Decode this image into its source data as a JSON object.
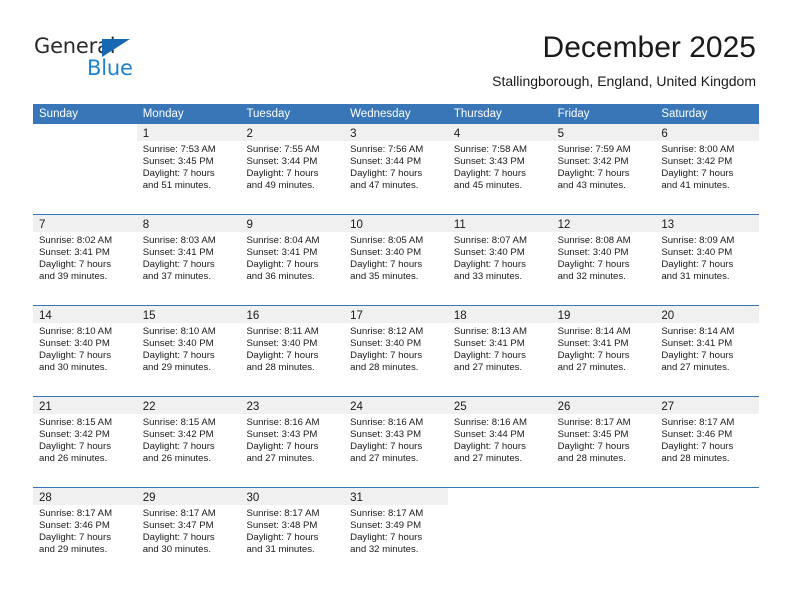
{
  "brand": {
    "name_top": "General",
    "name_bottom": "Blue",
    "triangle_color": "#1668b3",
    "blue_color": "#1f82d0"
  },
  "header": {
    "title": "December 2025",
    "subtitle": "Stallingborough, England, United Kingdom"
  },
  "colors": {
    "header_blue": "#3876b8",
    "daynum_band": "#f0f0f0",
    "text": "#1a1a1a"
  },
  "weekday_headers": [
    "Sunday",
    "Monday",
    "Tuesday",
    "Wednesday",
    "Thursday",
    "Friday",
    "Saturday"
  ],
  "weeks": [
    [
      {
        "blank": true
      },
      {
        "day": "1",
        "sunrise": "Sunrise: 7:53 AM",
        "sunset": "Sunset: 3:45 PM",
        "daylight1": "Daylight: 7 hours",
        "daylight2": "and 51 minutes."
      },
      {
        "day": "2",
        "sunrise": "Sunrise: 7:55 AM",
        "sunset": "Sunset: 3:44 PM",
        "daylight1": "Daylight: 7 hours",
        "daylight2": "and 49 minutes."
      },
      {
        "day": "3",
        "sunrise": "Sunrise: 7:56 AM",
        "sunset": "Sunset: 3:44 PM",
        "daylight1": "Daylight: 7 hours",
        "daylight2": "and 47 minutes."
      },
      {
        "day": "4",
        "sunrise": "Sunrise: 7:58 AM",
        "sunset": "Sunset: 3:43 PM",
        "daylight1": "Daylight: 7 hours",
        "daylight2": "and 45 minutes."
      },
      {
        "day": "5",
        "sunrise": "Sunrise: 7:59 AM",
        "sunset": "Sunset: 3:42 PM",
        "daylight1": "Daylight: 7 hours",
        "daylight2": "and 43 minutes."
      },
      {
        "day": "6",
        "sunrise": "Sunrise: 8:00 AM",
        "sunset": "Sunset: 3:42 PM",
        "daylight1": "Daylight: 7 hours",
        "daylight2": "and 41 minutes."
      }
    ],
    [
      {
        "day": "7",
        "sunrise": "Sunrise: 8:02 AM",
        "sunset": "Sunset: 3:41 PM",
        "daylight1": "Daylight: 7 hours",
        "daylight2": "and 39 minutes."
      },
      {
        "day": "8",
        "sunrise": "Sunrise: 8:03 AM",
        "sunset": "Sunset: 3:41 PM",
        "daylight1": "Daylight: 7 hours",
        "daylight2": "and 37 minutes."
      },
      {
        "day": "9",
        "sunrise": "Sunrise: 8:04 AM",
        "sunset": "Sunset: 3:41 PM",
        "daylight1": "Daylight: 7 hours",
        "daylight2": "and 36 minutes."
      },
      {
        "day": "10",
        "sunrise": "Sunrise: 8:05 AM",
        "sunset": "Sunset: 3:40 PM",
        "daylight1": "Daylight: 7 hours",
        "daylight2": "and 35 minutes."
      },
      {
        "day": "11",
        "sunrise": "Sunrise: 8:07 AM",
        "sunset": "Sunset: 3:40 PM",
        "daylight1": "Daylight: 7 hours",
        "daylight2": "and 33 minutes."
      },
      {
        "day": "12",
        "sunrise": "Sunrise: 8:08 AM",
        "sunset": "Sunset: 3:40 PM",
        "daylight1": "Daylight: 7 hours",
        "daylight2": "and 32 minutes."
      },
      {
        "day": "13",
        "sunrise": "Sunrise: 8:09 AM",
        "sunset": "Sunset: 3:40 PM",
        "daylight1": "Daylight: 7 hours",
        "daylight2": "and 31 minutes."
      }
    ],
    [
      {
        "day": "14",
        "sunrise": "Sunrise: 8:10 AM",
        "sunset": "Sunset: 3:40 PM",
        "daylight1": "Daylight: 7 hours",
        "daylight2": "and 30 minutes."
      },
      {
        "day": "15",
        "sunrise": "Sunrise: 8:10 AM",
        "sunset": "Sunset: 3:40 PM",
        "daylight1": "Daylight: 7 hours",
        "daylight2": "and 29 minutes."
      },
      {
        "day": "16",
        "sunrise": "Sunrise: 8:11 AM",
        "sunset": "Sunset: 3:40 PM",
        "daylight1": "Daylight: 7 hours",
        "daylight2": "and 28 minutes."
      },
      {
        "day": "17",
        "sunrise": "Sunrise: 8:12 AM",
        "sunset": "Sunset: 3:40 PM",
        "daylight1": "Daylight: 7 hours",
        "daylight2": "and 28 minutes."
      },
      {
        "day": "18",
        "sunrise": "Sunrise: 8:13 AM",
        "sunset": "Sunset: 3:41 PM",
        "daylight1": "Daylight: 7 hours",
        "daylight2": "and 27 minutes."
      },
      {
        "day": "19",
        "sunrise": "Sunrise: 8:14 AM",
        "sunset": "Sunset: 3:41 PM",
        "daylight1": "Daylight: 7 hours",
        "daylight2": "and 27 minutes."
      },
      {
        "day": "20",
        "sunrise": "Sunrise: 8:14 AM",
        "sunset": "Sunset: 3:41 PM",
        "daylight1": "Daylight: 7 hours",
        "daylight2": "and 27 minutes."
      }
    ],
    [
      {
        "day": "21",
        "sunrise": "Sunrise: 8:15 AM",
        "sunset": "Sunset: 3:42 PM",
        "daylight1": "Daylight: 7 hours",
        "daylight2": "and 26 minutes."
      },
      {
        "day": "22",
        "sunrise": "Sunrise: 8:15 AM",
        "sunset": "Sunset: 3:42 PM",
        "daylight1": "Daylight: 7 hours",
        "daylight2": "and 26 minutes."
      },
      {
        "day": "23",
        "sunrise": "Sunrise: 8:16 AM",
        "sunset": "Sunset: 3:43 PM",
        "daylight1": "Daylight: 7 hours",
        "daylight2": "and 27 minutes."
      },
      {
        "day": "24",
        "sunrise": "Sunrise: 8:16 AM",
        "sunset": "Sunset: 3:43 PM",
        "daylight1": "Daylight: 7 hours",
        "daylight2": "and 27 minutes."
      },
      {
        "day": "25",
        "sunrise": "Sunrise: 8:16 AM",
        "sunset": "Sunset: 3:44 PM",
        "daylight1": "Daylight: 7 hours",
        "daylight2": "and 27 minutes."
      },
      {
        "day": "26",
        "sunrise": "Sunrise: 8:17 AM",
        "sunset": "Sunset: 3:45 PM",
        "daylight1": "Daylight: 7 hours",
        "daylight2": "and 28 minutes."
      },
      {
        "day": "27",
        "sunrise": "Sunrise: 8:17 AM",
        "sunset": "Sunset: 3:46 PM",
        "daylight1": "Daylight: 7 hours",
        "daylight2": "and 28 minutes."
      }
    ],
    [
      {
        "day": "28",
        "sunrise": "Sunrise: 8:17 AM",
        "sunset": "Sunset: 3:46 PM",
        "daylight1": "Daylight: 7 hours",
        "daylight2": "and 29 minutes."
      },
      {
        "day": "29",
        "sunrise": "Sunrise: 8:17 AM",
        "sunset": "Sunset: 3:47 PM",
        "daylight1": "Daylight: 7 hours",
        "daylight2": "and 30 minutes."
      },
      {
        "day": "30",
        "sunrise": "Sunrise: 8:17 AM",
        "sunset": "Sunset: 3:48 PM",
        "daylight1": "Daylight: 7 hours",
        "daylight2": "and 31 minutes."
      },
      {
        "day": "31",
        "sunrise": "Sunrise: 8:17 AM",
        "sunset": "Sunset: 3:49 PM",
        "daylight1": "Daylight: 7 hours",
        "daylight2": "and 32 minutes."
      },
      {
        "blank": true
      },
      {
        "blank": true
      },
      {
        "blank": true
      }
    ]
  ]
}
